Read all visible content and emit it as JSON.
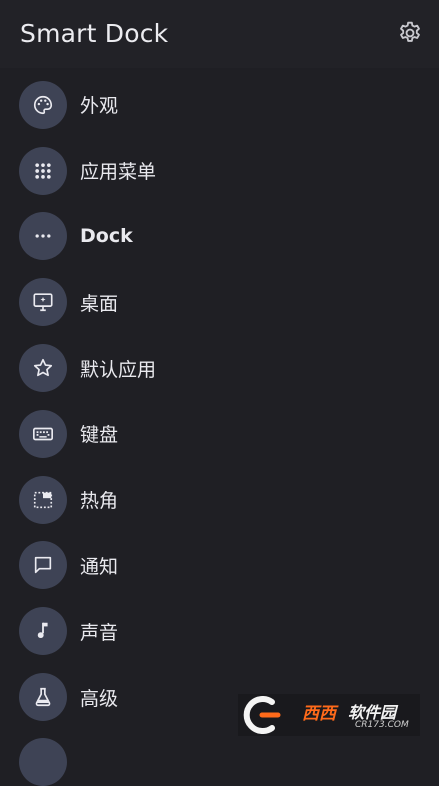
{
  "header": {
    "title": "Smart Dock",
    "settings_icon": "gear-icon"
  },
  "menu": [
    {
      "label": "外观",
      "icon": "palette-icon"
    },
    {
      "label": "应用菜单",
      "icon": "grid-dots-icon"
    },
    {
      "label": "Dock",
      "icon": "more-horizontal-icon"
    },
    {
      "label": "桌面",
      "icon": "desktop-icon"
    },
    {
      "label": "默认应用",
      "icon": "star-icon"
    },
    {
      "label": "键盘",
      "icon": "keyboard-icon"
    },
    {
      "label": "热角",
      "icon": "hot-corner-icon"
    },
    {
      "label": "通知",
      "icon": "notification-icon"
    },
    {
      "label": "声音",
      "icon": "music-note-icon"
    },
    {
      "label": "高级",
      "icon": "flask-icon"
    }
  ],
  "watermark": {
    "brand": "西西",
    "cn": "软件园",
    "url": "CR173.COM"
  },
  "colors": {
    "background": "#1f1f24",
    "icon_circle": "#3e4355",
    "text": "#e9e9ee"
  }
}
